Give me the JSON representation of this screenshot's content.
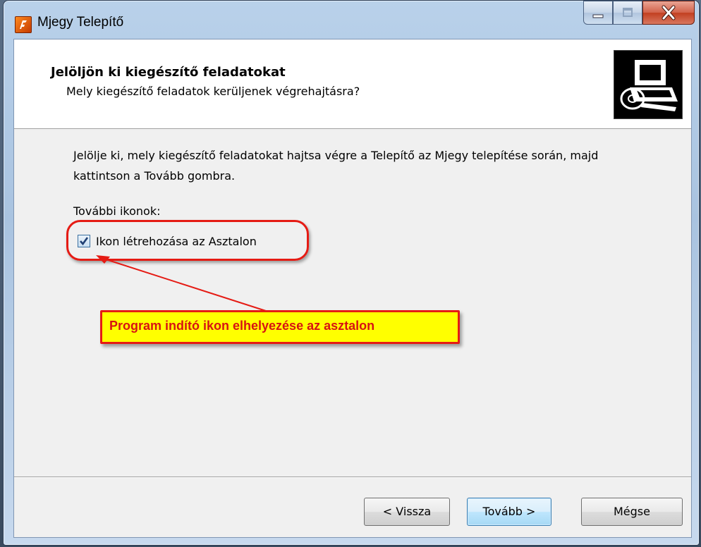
{
  "window": {
    "title": "Mjegy Telepítő",
    "app_icon": "app-logo-icon",
    "caption_buttons": [
      "minimize-icon",
      "maximize-icon",
      "close-icon"
    ]
  },
  "header": {
    "title": "Jelöljön ki kiegészítő feladatokat",
    "subtitle": "Mely kiegészítő feladatok kerüljenek végrehajtásra?",
    "image": "computer-disc-icon"
  },
  "content": {
    "description": "Jelölje ki, mely kiegészítő feladatokat hajtsa végre a Telepítő az Mjegy telepítése során, majd kattintson a Tovább gombra.",
    "group_label": "További ikonok:",
    "checkbox": {
      "label": "Ikon létrehozása az Asztalon",
      "checked": true
    }
  },
  "annotation": {
    "callout_text": "Program indító ikon elhelyezése az asztalon",
    "color": "#e51b14",
    "callout_background": "#ffff00"
  },
  "buttons": {
    "back": "< Vissza",
    "next": "Tovább >",
    "cancel": "Mégse"
  }
}
